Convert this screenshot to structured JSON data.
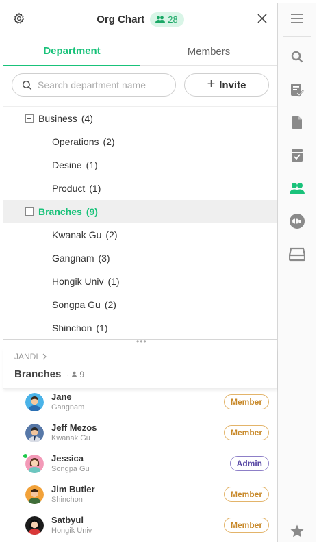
{
  "header": {
    "title": "Org Chart",
    "member_count": "28"
  },
  "tabs": [
    {
      "label": "Department",
      "active": true
    },
    {
      "label": "Members",
      "active": false
    }
  ],
  "search": {
    "placeholder": "Search department name",
    "value": ""
  },
  "invite": {
    "label": "Invite"
  },
  "tree": [
    {
      "name": "Business",
      "count": "(4)",
      "level": 0,
      "expanded": true,
      "selected": false
    },
    {
      "name": "Operations",
      "count": "(2)",
      "level": 1,
      "selected": false
    },
    {
      "name": "Desine",
      "count": "(1)",
      "level": 1,
      "selected": false
    },
    {
      "name": "Product",
      "count": "(1)",
      "level": 1,
      "selected": false
    },
    {
      "name": "Branches",
      "count": "(9)",
      "level": 0,
      "expanded": true,
      "selected": true
    },
    {
      "name": "Kwanak Gu",
      "count": "(2)",
      "level": 1,
      "selected": false
    },
    {
      "name": "Gangnam",
      "count": "(3)",
      "level": 1,
      "selected": false
    },
    {
      "name": "Hongik Univ",
      "count": "(1)",
      "level": 1,
      "selected": false
    },
    {
      "name": "Songpa Gu",
      "count": "(2)",
      "level": 1,
      "selected": false
    },
    {
      "name": "Shinchon",
      "count": "(1)",
      "level": 1,
      "selected": false
    }
  ],
  "breadcrumb": {
    "root": "JANDI"
  },
  "group": {
    "name": "Branches",
    "count": "9"
  },
  "members": [
    {
      "name": "Jane",
      "team": "Gangnam",
      "role": "Member",
      "online": false,
      "avatar": "avatar-blue"
    },
    {
      "name": "Jeff Mezos",
      "team": "Kwanak Gu",
      "role": "Member",
      "online": false,
      "avatar": "avatar-navy"
    },
    {
      "name": "Jessica",
      "team": "Songpa Gu",
      "role": "Admin",
      "online": true,
      "avatar": "avatar-pink"
    },
    {
      "name": "Jim Butler",
      "team": "Shinchon",
      "role": "Member",
      "online": false,
      "avatar": "avatar-orange"
    },
    {
      "name": "Satbyul",
      "team": "Hongik Univ",
      "role": "Member",
      "online": false,
      "avatar": "avatar-black"
    }
  ],
  "rail": [
    {
      "icon": "menu-icon"
    },
    {
      "icon": "search-icon"
    },
    {
      "icon": "todo-icon"
    },
    {
      "icon": "file-icon"
    },
    {
      "icon": "archive-icon"
    },
    {
      "icon": "org-chart-icon",
      "active": true
    },
    {
      "icon": "connect-icon"
    },
    {
      "icon": "inbox-icon"
    },
    {
      "icon": "star-icon"
    }
  ],
  "colors": {
    "accent": "#19c27a",
    "member_badge": "#c8892a",
    "admin_badge": "#5a4aa5",
    "icon_gray": "#8a8a8a"
  }
}
